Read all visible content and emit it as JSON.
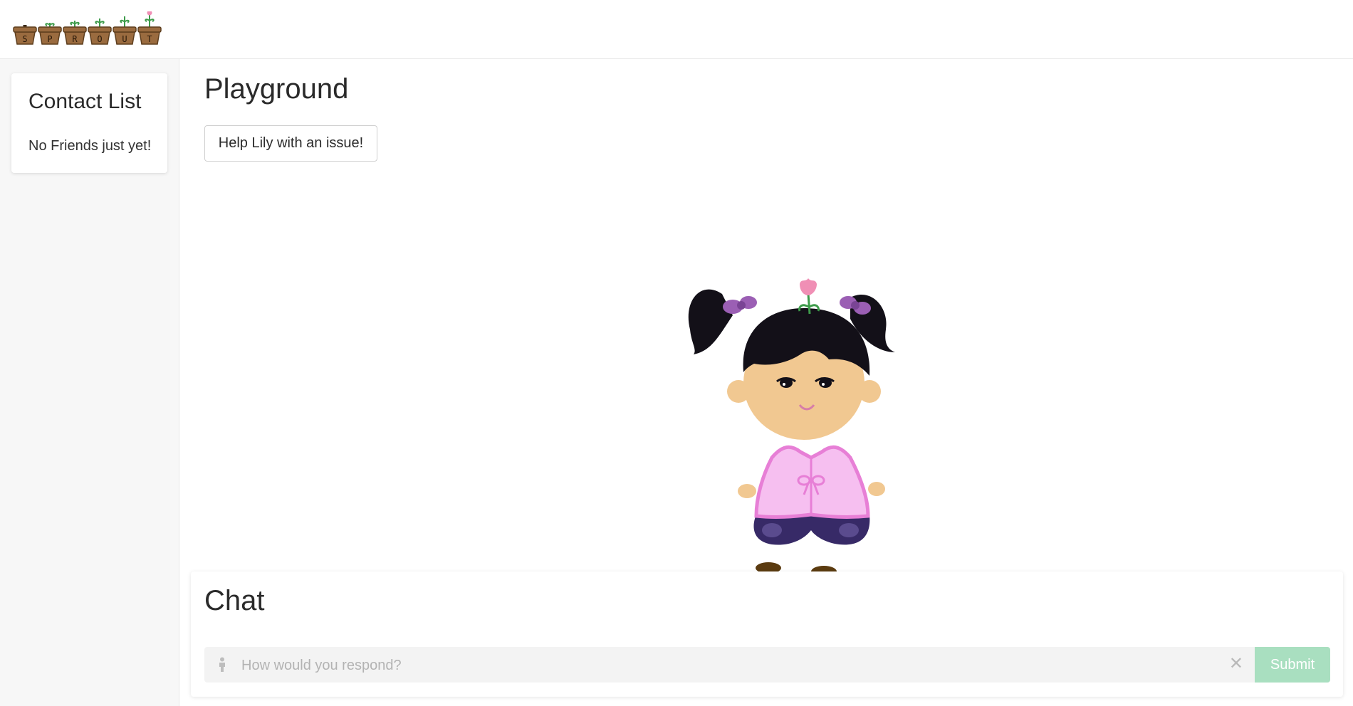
{
  "header": {
    "logo_letters": [
      "S",
      "P",
      "R",
      "O",
      "U",
      "T"
    ]
  },
  "sidebar": {
    "title": "Contact List",
    "empty_text": "No Friends just yet!"
  },
  "playground": {
    "title": "Playground",
    "help_button_label": "Help Lily with an issue!",
    "character_icon": "lily-character-illustration"
  },
  "chat": {
    "title": "Chat",
    "input_placeholder": "How would you respond?",
    "input_value": "",
    "person_icon": "person-icon",
    "clear_icon": "close-icon",
    "submit_label": "Submit"
  },
  "colors": {
    "pot": "#9a6b3f",
    "submit_disabled": "#a9dfc0",
    "sidebar_bg": "#f7f7f7",
    "shirt": "#f6bff0",
    "pants": "#372a67",
    "hair": "#131018",
    "skin": "#f1c891"
  }
}
